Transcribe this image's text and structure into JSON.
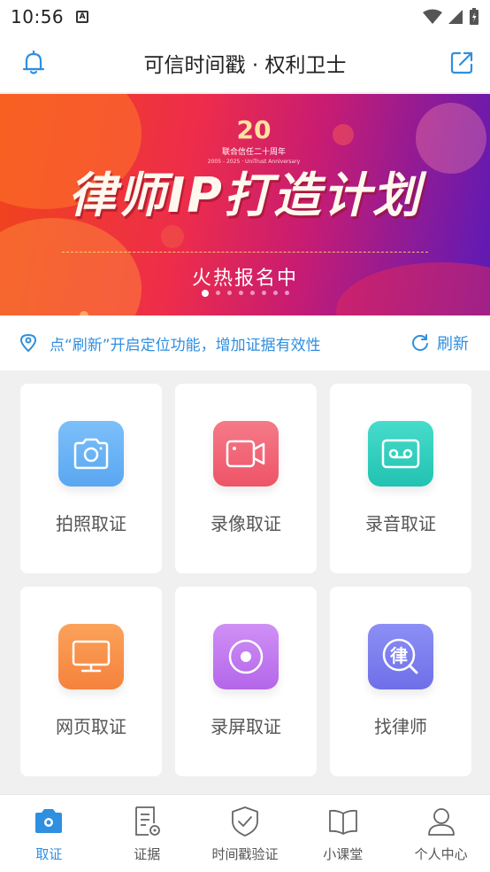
{
  "status_bar": {
    "time": "10:56",
    "notif_letter": "A"
  },
  "header": {
    "title": "可信时间戳 · 权利卫士"
  },
  "banner": {
    "logo_number": "20",
    "logo_line1": "联合信任二十周年",
    "logo_line2": "2005 - 2025 · UniTrust Anniversary",
    "title": "律师IP打造计划",
    "subtitle": "火热报名中",
    "slide_count": 8,
    "active_slide": 0
  },
  "location": {
    "hint": "点“刷新”开启定位功能，增加证据有效性",
    "refresh_label": "刷新"
  },
  "features": [
    {
      "label": "拍照取证",
      "icon": "camera-icon",
      "color": "#6cb6f5"
    },
    {
      "label": "录像取证",
      "icon": "video-icon",
      "color": "#f2677a"
    },
    {
      "label": "录音取证",
      "icon": "tape-icon",
      "color": "#35d2c2"
    },
    {
      "label": "网页取证",
      "icon": "monitor-icon",
      "color": "#f7934a"
    },
    {
      "label": "录屏取证",
      "icon": "screen-record-icon",
      "color": "#c27af0"
    },
    {
      "label": "找律师",
      "icon": "lawyer-icon",
      "color": "#7d7ef0"
    }
  ],
  "tabs": [
    {
      "label": "取证",
      "icon": "camera-icon",
      "active": true
    },
    {
      "label": "证据",
      "icon": "document-icon",
      "active": false
    },
    {
      "label": "时间戳验证",
      "icon": "shield-check-icon",
      "active": false
    },
    {
      "label": "小课堂",
      "icon": "book-icon",
      "active": false
    },
    {
      "label": "个人中心",
      "icon": "user-icon",
      "active": false
    }
  ],
  "colors": {
    "accent": "#2f8fe0"
  }
}
